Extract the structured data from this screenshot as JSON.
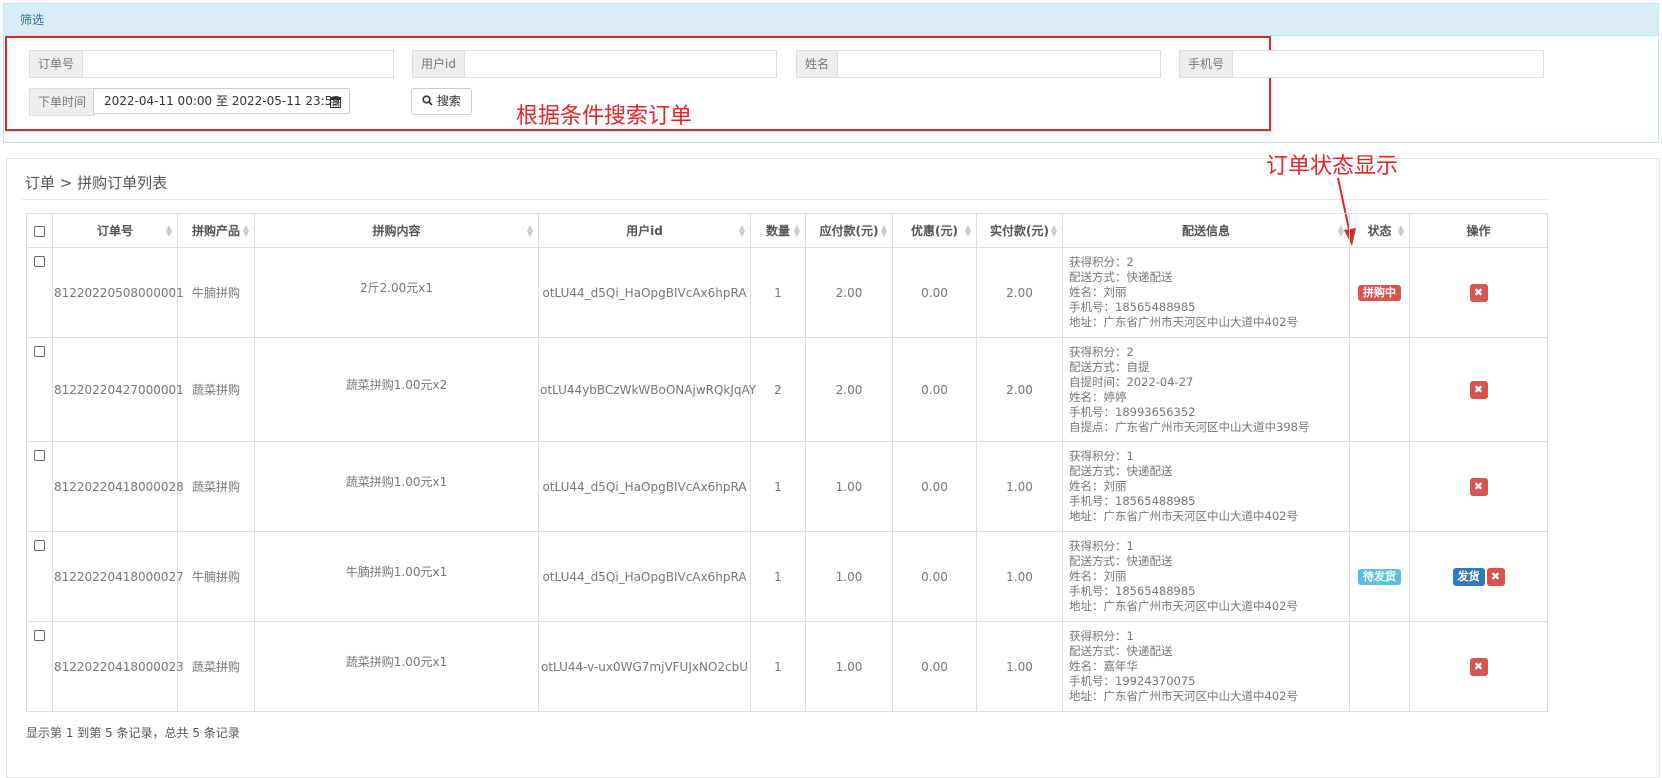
{
  "filter": {
    "heading": "筛选",
    "order_no_label": "订单号",
    "order_no_value": "",
    "user_id_label": "用户id",
    "user_id_value": "",
    "name_label": "姓名",
    "name_value": "",
    "phone_label": "手机号",
    "phone_value": "",
    "order_time_label": "下单时间",
    "order_time_value": "2022-04-11 00:00 至 2022-05-11 23:59",
    "search_label": "搜索"
  },
  "annotations": {
    "search_note": "根据条件搜索订单",
    "status_note": "订单状态显示"
  },
  "breadcrumb": {
    "root": "订单",
    "separator": ">",
    "current": "拼购订单列表"
  },
  "table": {
    "columns": [
      "订单号",
      "拼购产品",
      "拼购内容",
      "用户id",
      "数量",
      "应付款(元)",
      "优惠(元)",
      "实付款(元)",
      "配送信息",
      "状态",
      "操作"
    ],
    "rows": [
      {
        "order_no": "81220220508000001",
        "product": "牛腩拼购",
        "content": "2斤2.00元x1",
        "user_id": "otLU44_d5Qi_HaOpgBIVcAx6hpRA",
        "qty": "1",
        "payable": "2.00",
        "discount": "0.00",
        "paid": "2.00",
        "shipping": [
          "获得积分：2",
          "配送方式：快递配送",
          "姓名：刘丽",
          "手机号：18565488985",
          "地址：广东省广州市天河区中山大道中402号"
        ],
        "status": "拼购中",
        "status_color": "#d9534f",
        "ship_action": ""
      },
      {
        "order_no": "81220220427000001",
        "product": "蔬菜拼购",
        "content": "蔬菜拼购1.00元x2",
        "user_id": "otLU44ybBCzWkWBoONAjwRQkJqAY",
        "qty": "2",
        "payable": "2.00",
        "discount": "0.00",
        "paid": "2.00",
        "shipping": [
          "获得积分：2",
          "配送方式：自提",
          "自提时间：2022-04-27",
          "姓名：婷婷",
          "手机号：18993656352",
          "自提点：广东省广州市天河区中山大道中398号"
        ],
        "status": "",
        "status_color": "",
        "ship_action": ""
      },
      {
        "order_no": "81220220418000028",
        "product": "蔬菜拼购",
        "content": "蔬菜拼购1.00元x1",
        "user_id": "otLU44_d5Qi_HaOpgBIVcAx6hpRA",
        "qty": "1",
        "payable": "1.00",
        "discount": "0.00",
        "paid": "1.00",
        "shipping": [
          "获得积分：1",
          "配送方式：快递配送",
          "姓名：刘丽",
          "手机号：18565488985",
          "地址：广东省广州市天河区中山大道中402号"
        ],
        "status": "",
        "status_color": "",
        "ship_action": ""
      },
      {
        "order_no": "81220220418000027",
        "product": "牛腩拼购",
        "content": "牛腩拼购1.00元x1",
        "user_id": "otLU44_d5Qi_HaOpgBIVcAx6hpRA",
        "qty": "1",
        "payable": "1.00",
        "discount": "0.00",
        "paid": "1.00",
        "shipping": [
          "获得积分：1",
          "配送方式：快递配送",
          "姓名：刘丽",
          "手机号：18565488985",
          "地址：广东省广州市天河区中山大道中402号"
        ],
        "status": "待发货",
        "status_color": "#5bc0de",
        "ship_action": "发货"
      },
      {
        "order_no": "81220220418000023",
        "product": "蔬菜拼购",
        "content": "蔬菜拼购1.00元x1",
        "user_id": "otLU44-v-ux0WG7mjVFUJxNO2cbU",
        "qty": "1",
        "payable": "1.00",
        "discount": "0.00",
        "paid": "1.00",
        "shipping": [
          "获得积分：1",
          "配送方式：快递配送",
          "姓名：嘉年华",
          "手机号：19924370075",
          "地址：广东省广州市天河区中山大道中402号"
        ],
        "status": "",
        "status_color": "",
        "ship_action": ""
      }
    ]
  },
  "footer": {
    "summary": "显示第 1 到第 5 条记录，总共 5 条记录"
  },
  "colors": {
    "annotation": "#e0262b",
    "delete": "#d9534f",
    "ship": "#337ab7",
    "panel_header": "#d9edf7"
  }
}
